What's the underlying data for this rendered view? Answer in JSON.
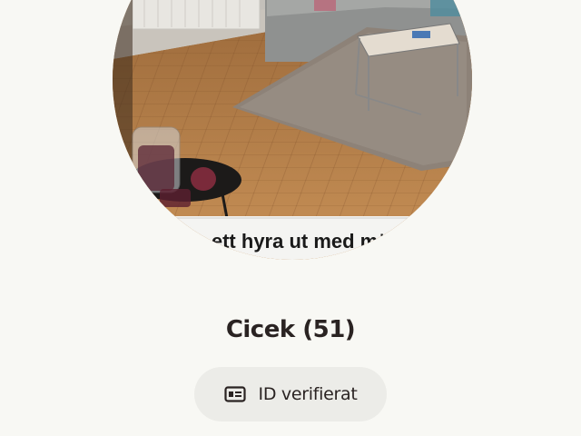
{
  "profile": {
    "photo_caption": "ett hyra ut med möb",
    "name": "Cicek",
    "age": "(51)",
    "verification": {
      "icon": "id-card-icon",
      "label": "ID verifierat"
    }
  },
  "colors": {
    "background": "#f8f8f4",
    "text": "#2a2322",
    "pill_background": "#ecece8"
  }
}
